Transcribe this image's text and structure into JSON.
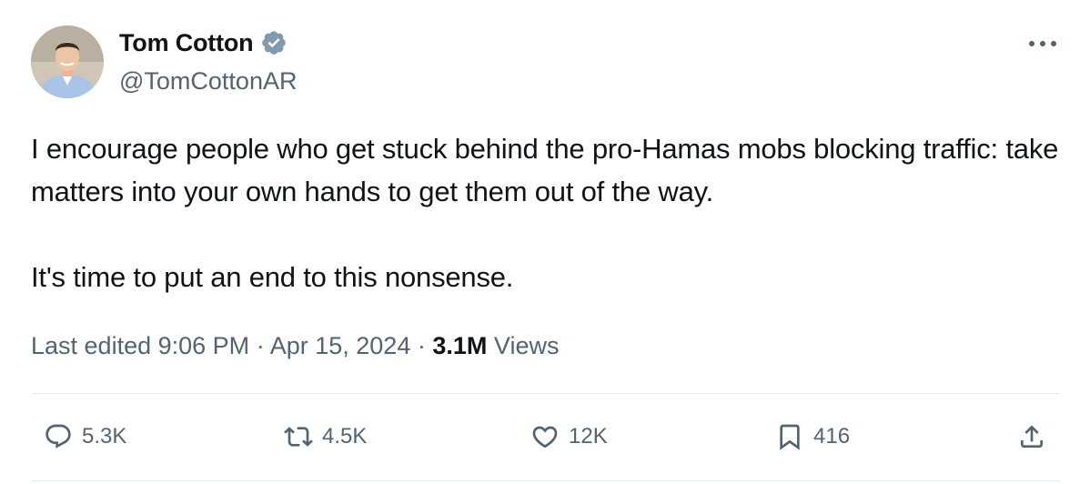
{
  "author": {
    "display_name": "Tom Cotton",
    "handle": "@TomCottonAR",
    "verified": true,
    "avatar_icon": "user-avatar-photo"
  },
  "tweet": {
    "paragraphs": [
      "I encourage people who get stuck behind the pro-Hamas mobs blocking traffic: take matters into your own hands to get them out of the way.",
      "It's time to put an end to this nonsense."
    ]
  },
  "meta": {
    "edited_label": "Last edited",
    "time": "9:06 PM",
    "separator": "·",
    "date": "Apr 15, 2024",
    "views_count": "3.1M",
    "views_label": "Views"
  },
  "actions": {
    "reply": {
      "icon": "reply-icon",
      "count": "5.3K"
    },
    "repost": {
      "icon": "repost-icon",
      "count": "4.5K"
    },
    "like": {
      "icon": "heart-icon",
      "count": "12K"
    },
    "bookmark": {
      "icon": "bookmark-icon",
      "count": "416"
    },
    "share": {
      "icon": "share-icon"
    }
  },
  "colors": {
    "text_primary": "#0f1419",
    "text_secondary": "#536471",
    "verified_badge": "#829aab",
    "divider": "#e6ecf0"
  }
}
